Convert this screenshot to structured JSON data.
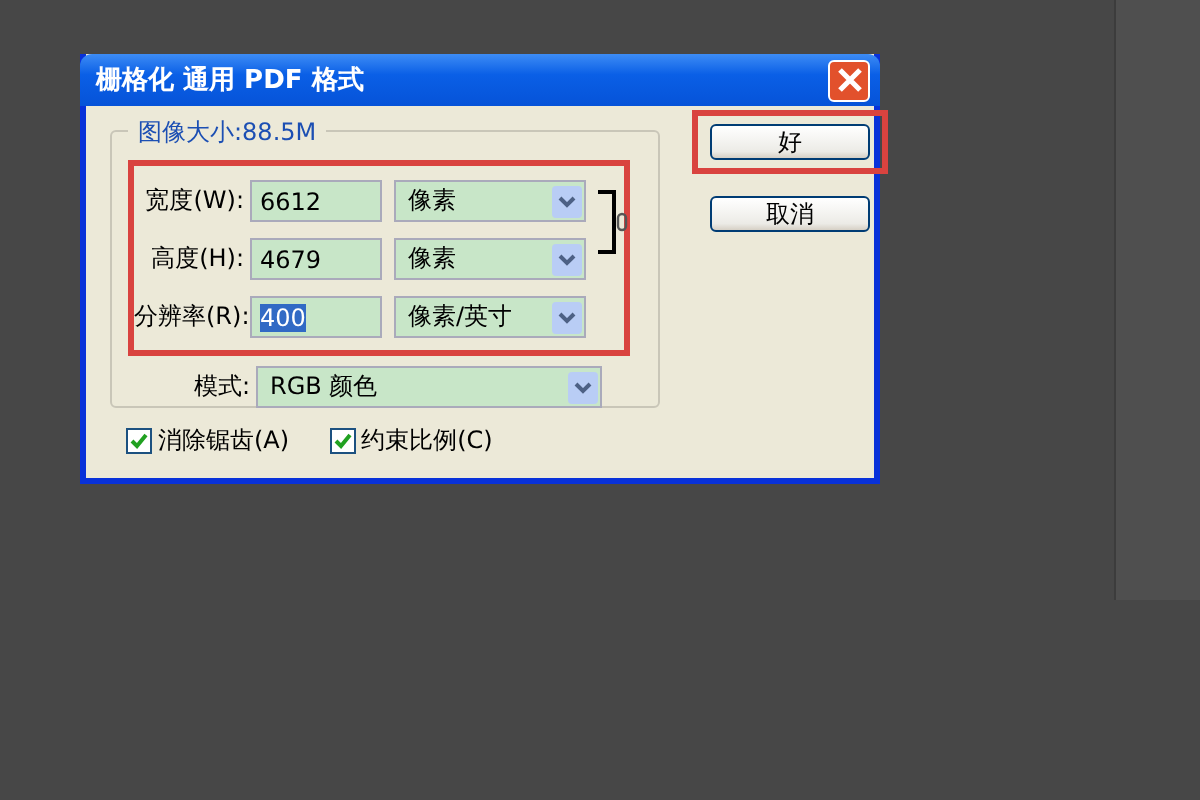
{
  "window": {
    "title": "栅格化 通用 PDF 格式"
  },
  "image_size": {
    "legend": "图像大小:88.5M",
    "highlighted": true,
    "dimensions_linked": true,
    "rows": [
      {
        "label": "宽度(W):",
        "value": "6612",
        "unit": "像素",
        "text_selected": false
      },
      {
        "label": "高度(H):",
        "value": "4679",
        "unit": "像素",
        "text_selected": false
      },
      {
        "label": "分辨率(R):",
        "value": "400",
        "unit": "像素/英寸",
        "text_selected": true
      }
    ],
    "mode": {
      "label": "模式:",
      "value": "RGB 颜色"
    }
  },
  "buttons": [
    {
      "label": "好",
      "highlighted": true
    },
    {
      "label": "取消",
      "highlighted": false
    }
  ],
  "checkboxes": [
    {
      "label": "消除锯齿(A)",
      "checked": true
    },
    {
      "label": "约束比例(C)",
      "checked": true
    }
  ]
}
